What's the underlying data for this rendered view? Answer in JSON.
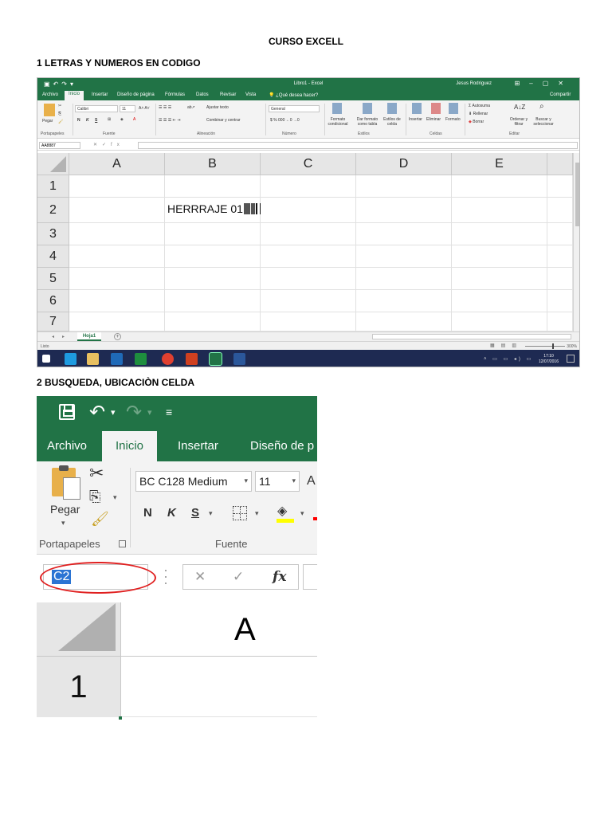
{
  "document": {
    "title": "CURSO EXCELL",
    "section1": "1 LETRAS Y NUMEROS EN CODIGO",
    "section2": "2 BUSQUEDA, UBICACIÒN CELDA"
  },
  "shot1": {
    "window_title": "Libro1 - Excel",
    "user": "Jesus Rodriguez",
    "tabs": [
      "Archivo",
      "Inicio",
      "Insertar",
      "Diseño de página",
      "Fórmulas",
      "Datos",
      "Revisar",
      "Vista"
    ],
    "active_tab": "Inicio",
    "tell_me": "¿Qué desea hacer?",
    "share": "Compartir",
    "ribbon": {
      "paste": "Pegar",
      "font_name": "Calibri",
      "font_size": "11",
      "bold": "N",
      "italic": "K",
      "underline": "S",
      "wrap_text": "Ajustar texto",
      "merge": "Combinar y centrar",
      "number_format": "General",
      "cond_format": "Formato condicional",
      "table_format": "Dar formato como tabla",
      "cell_styles": "Estilos de celda",
      "insert": "Insertar",
      "delete": "Eliminar",
      "format": "Formato",
      "autosum": "Autosuma",
      "fill": "Rellenar",
      "clear": "Borrar",
      "sort": "Ordenar y filtrar",
      "find": "Buscar y seleccionar",
      "groups": [
        "Portapapeles",
        "Fuente",
        "Alineación",
        "Número",
        "Estilos",
        "Celdas",
        "Editar"
      ]
    },
    "name_box": "AA8887",
    "columns": [
      "A",
      "B",
      "C",
      "D",
      "E"
    ],
    "rows": [
      "1",
      "2",
      "3",
      "4",
      "5",
      "6",
      "7"
    ],
    "cell_text": "HERRRAJE 01",
    "sheet_tab": "Hoja1",
    "status_ready": "Listo",
    "zoom": "300%",
    "clock_time": "17:10",
    "clock_date": "12/07/2016"
  },
  "shot2": {
    "tabs": [
      "Archivo",
      "Inicio",
      "Insertar",
      "Diseño de p"
    ],
    "active_tab": "Inicio",
    "paste": "Pegar",
    "font_name": "BC C128 Medium",
    "font_size": "11",
    "grow_font": "A",
    "bold": "N",
    "italic": "K",
    "underline": "S",
    "group_clipboard": "Portapapeles",
    "group_font": "Fuente",
    "name_box": "C2",
    "column": "A",
    "row": "1",
    "highlight_color": "#e02020"
  }
}
